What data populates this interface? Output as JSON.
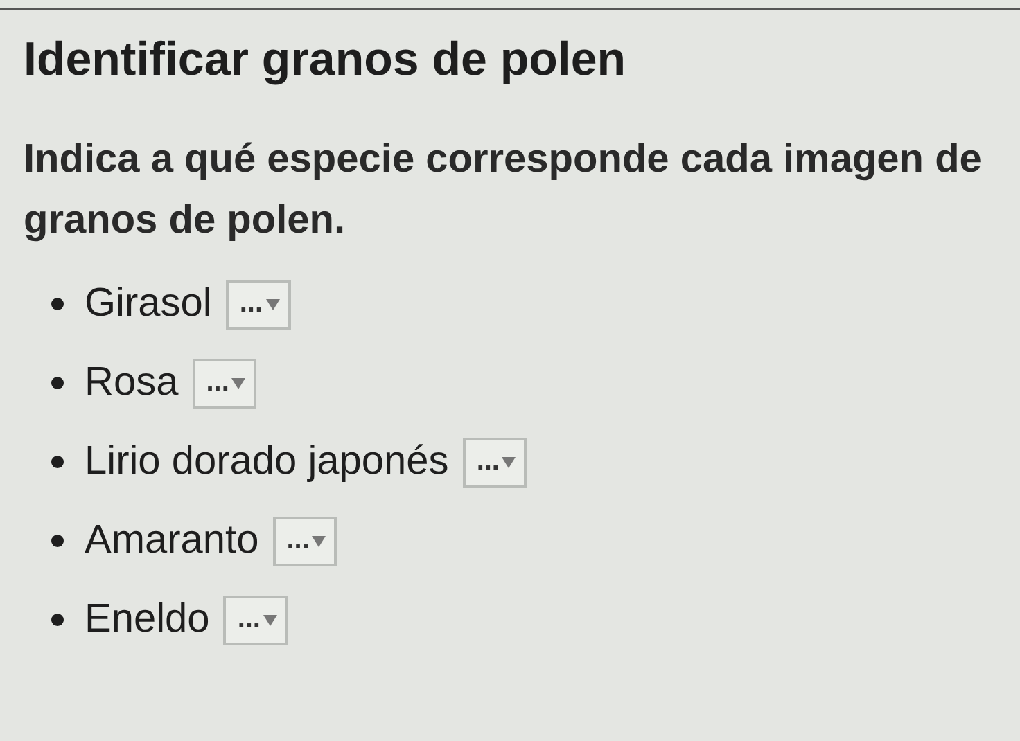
{
  "title": "Identificar granos de polen",
  "instructions": "Indica a qué especie corresponde cada imagen de granos de polen.",
  "items": [
    {
      "label": "Girasol",
      "answer": "..."
    },
    {
      "label": "Rosa",
      "answer": "..."
    },
    {
      "label": "Lirio dorado japonés",
      "answer": "..."
    },
    {
      "label": "Amaranto",
      "answer": "..."
    },
    {
      "label": "Eneldo",
      "answer": "..."
    }
  ]
}
